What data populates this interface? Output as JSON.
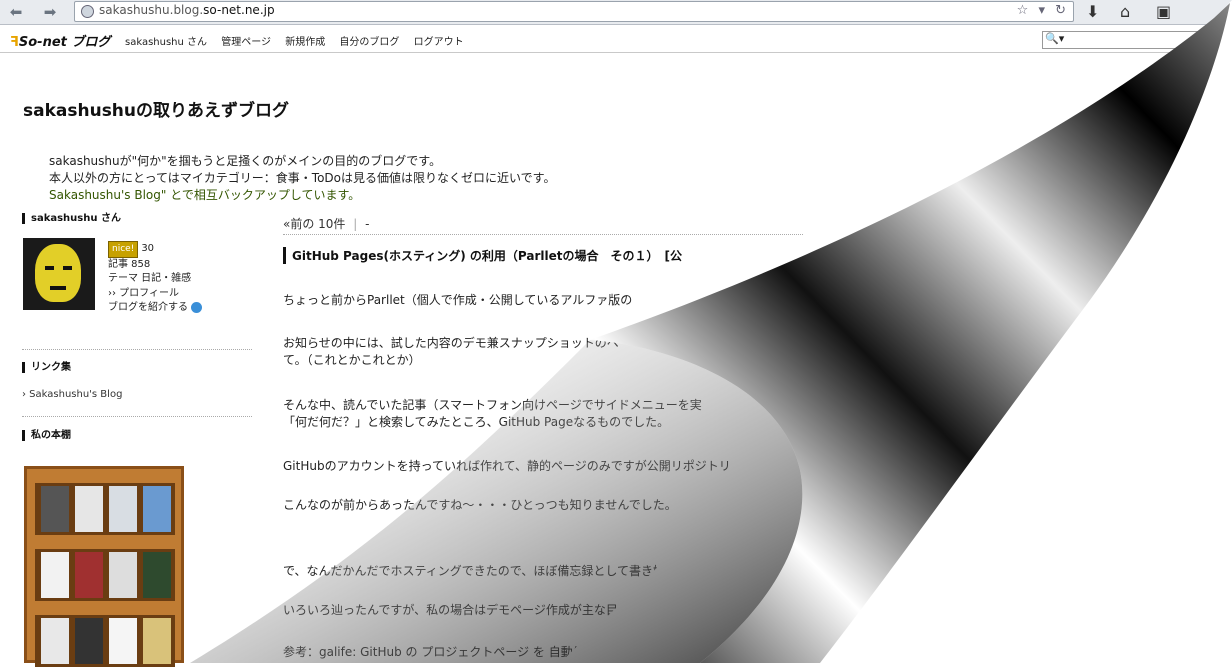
{
  "browser": {
    "url_prefix": "sakashushu.blog.",
    "url_domain": "so-net.ne.jp",
    "icons": [
      "back-icon",
      "forward-icon",
      "globe-icon",
      "star-icon",
      "reload-icon",
      "download-icon",
      "home-icon",
      "bookmark-icon"
    ]
  },
  "sonet_bar": {
    "logo": "So-net",
    "logo_suffix": "ブログ",
    "nav": [
      "sakashushu さん",
      "管理ページ",
      "新規作成",
      "自分のブログ",
      "ログアウト"
    ]
  },
  "blog": {
    "title": "sakashushuの取りあえずブログ",
    "description": [
      "sakashushuが\"何か\"を掴もうと足掻くのがメインの目的のブログです。",
      "本人以外の方にとってはマイカテゴリー：食事・ToDoは見る価値は限りなくゼロに近いです。",
      "Sakashushu's Blog\" とで相互バックアップしています。"
    ]
  },
  "sidebar": {
    "profile_heading": "sakashushu さん",
    "nice_label": "nice!",
    "nice_count": "30",
    "articles": "記事 858",
    "theme": "テーマ 日記・雑感",
    "profile_link": "›› プロフィール",
    "introduce_link": "ブログを紹介する",
    "links_heading": "リンク集",
    "links": [
      "› Sakashushu's Blog"
    ],
    "bookshelf_heading": "私の本棚"
  },
  "main": {
    "pager_prev": "«前の 10件",
    "pager_sep": "|",
    "pager_next": "-",
    "entry_title": "GitHub Pages(ホスティング) の利用（Parlletの場合　その１）　[公",
    "paragraphs": [
      "ちょっと前からParllet（個人で作成・公開しているアルファ版の",
      "お知らせの中には、試した内容のデモ兼スナップショットのペー",
      "て。（これとかこれとか）",
      "そんな中、読んでいた記事（スマートフォン向けページでサイドメニューを実",
      "「何だ何だ？」と検索してみたところ、GitHub Pageなるものでした。",
      "GitHubのアカウントを持っていれば作れて、静的ページのみですが公開リポジトリ",
      "こんなのが前からあったんですね〜・・・ひとっつも知りませんでした。",
      "で、なんだかんだでホスティングできたので、ほぼ備忘録として書き始めます。",
      "いろいろ辿ったんですが、私の場合はデモページ作成が主な目的なので、",
      "参考：galife: GitHub の プロジェクトページ を 自動生成 & 公開"
    ]
  },
  "colors": {
    "link_green": "#335500",
    "nice_gold": "#c7a100",
    "shelf_wood": "#c07c33"
  }
}
